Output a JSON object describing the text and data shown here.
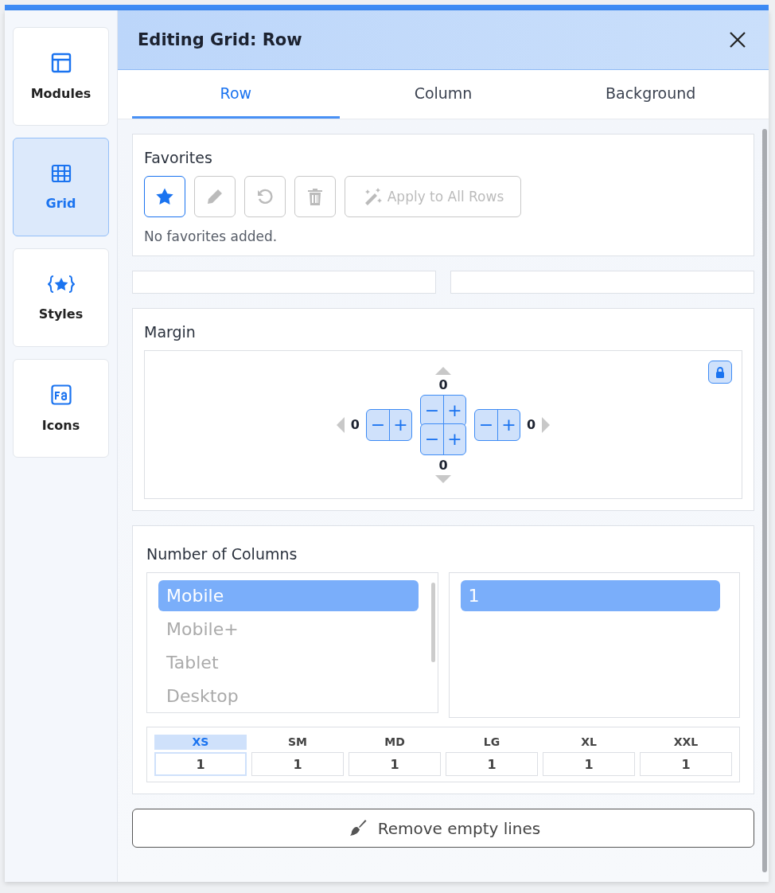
{
  "sidebar": {
    "items": [
      {
        "label": "Modules",
        "kind": "layout",
        "selected": false
      },
      {
        "label": "Grid",
        "kind": "grid",
        "selected": true
      },
      {
        "label": "Styles",
        "kind": "styles",
        "selected": false
      },
      {
        "label": "Icons",
        "kind": "fa",
        "selected": false
      }
    ]
  },
  "dialog": {
    "title": "Editing Grid: Row"
  },
  "tabs": [
    {
      "label": "Row",
      "selected": true
    },
    {
      "label": "Column",
      "selected": false
    },
    {
      "label": "Background",
      "selected": false
    }
  ],
  "favorites": {
    "title": "Favorites",
    "buttons": [
      {
        "kind": "star",
        "selected": true,
        "disabled": false
      },
      {
        "kind": "pencil",
        "selected": false,
        "disabled": true
      },
      {
        "kind": "undo",
        "selected": false,
        "disabled": true
      },
      {
        "kind": "trash",
        "selected": false,
        "disabled": true
      },
      {
        "kind": "apply",
        "label": "Apply to All Rows",
        "selected": false,
        "disabled": true
      }
    ],
    "empty_text": "No favorites added."
  },
  "margin": {
    "title": "Margin",
    "top": {
      "value": "0",
      "minus": "−",
      "plus": "+"
    },
    "left": {
      "value": "0",
      "minus": "−",
      "plus": "+"
    },
    "right": {
      "value": "0",
      "minus": "−",
      "plus": "+"
    },
    "bottom": {
      "value": "0",
      "minus": "−",
      "plus": "+"
    },
    "locked": true
  },
  "columns": {
    "title": "Number of Columns",
    "devices": [
      {
        "label": "Mobile",
        "selected": true
      },
      {
        "label": "Mobile+",
        "selected": false
      },
      {
        "label": "Tablet",
        "selected": false
      },
      {
        "label": "Desktop",
        "selected": false
      }
    ],
    "counts": [
      {
        "label": "1",
        "selected": true
      }
    ],
    "breakpoints": [
      {
        "label": "XS",
        "value": "1",
        "selected": true
      },
      {
        "label": "SM",
        "value": "1",
        "selected": false
      },
      {
        "label": "MD",
        "value": "1",
        "selected": false
      },
      {
        "label": "LG",
        "value": "1",
        "selected": false
      },
      {
        "label": "XL",
        "value": "1",
        "selected": false
      },
      {
        "label": "XXL",
        "value": "1",
        "selected": false
      }
    ]
  },
  "remove_button": "Remove empty lines"
}
